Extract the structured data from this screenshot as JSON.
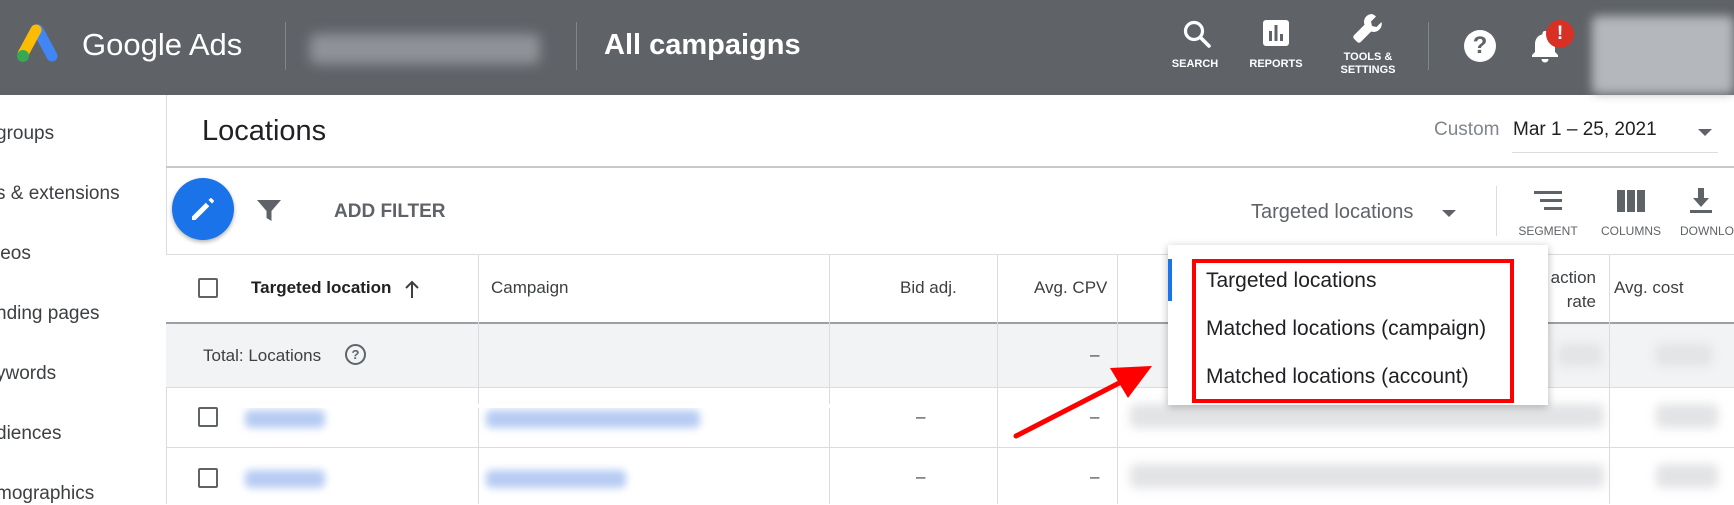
{
  "app": {
    "logo_text": "Google Ads",
    "page_title": "All campaigns"
  },
  "topnav": [
    {
      "label": "SEARCH",
      "icon": "search-icon"
    },
    {
      "label": "REPORTS",
      "icon": "reports-icon"
    },
    {
      "label": "TOOLS & SETTINGS",
      "icon": "wrench-icon"
    }
  ],
  "notification_badge": "!",
  "sidebar": {
    "items": [
      "groups",
      "s & extensions",
      "leos",
      "nding pages",
      "ywords",
      "diences",
      "mographics"
    ]
  },
  "header": {
    "title": "Locations",
    "date_label": "Custom",
    "date_range": "Mar 1 – 25, 2021"
  },
  "toolbar": {
    "add_filter": "ADD FILTER",
    "view_select": "Targeted locations",
    "tools": [
      {
        "label": "SEGMENT",
        "icon": "segment-icon"
      },
      {
        "label": "COLUMNS",
        "icon": "columns-icon"
      },
      {
        "label": "DOWNLO",
        "icon": "download-icon"
      }
    ]
  },
  "table": {
    "headers": {
      "targeted_location": "Targeted location",
      "campaign": "Campaign",
      "bid_adj": "Bid adj.",
      "avg_cpv": "Avg. CPV",
      "interaction_rate": "action\nrate",
      "avg_cost": "Avg. cost"
    },
    "total_label": "Total: Locations",
    "total_avg_cpv": "–",
    "rows": [
      {
        "bid_adj": "–",
        "avg_cpv": "–"
      },
      {
        "bid_adj": "–",
        "avg_cpv": "–"
      }
    ]
  },
  "dropdown": {
    "options": [
      "Targeted locations",
      "Matched locations (campaign)",
      "Matched locations (account)"
    ],
    "highlight_color": "#ff0000"
  },
  "colors": {
    "topbar": "#5f6368",
    "accent_blue": "#1a73e8",
    "annotation_red": "#ff0000",
    "badge_red": "#d93025"
  }
}
